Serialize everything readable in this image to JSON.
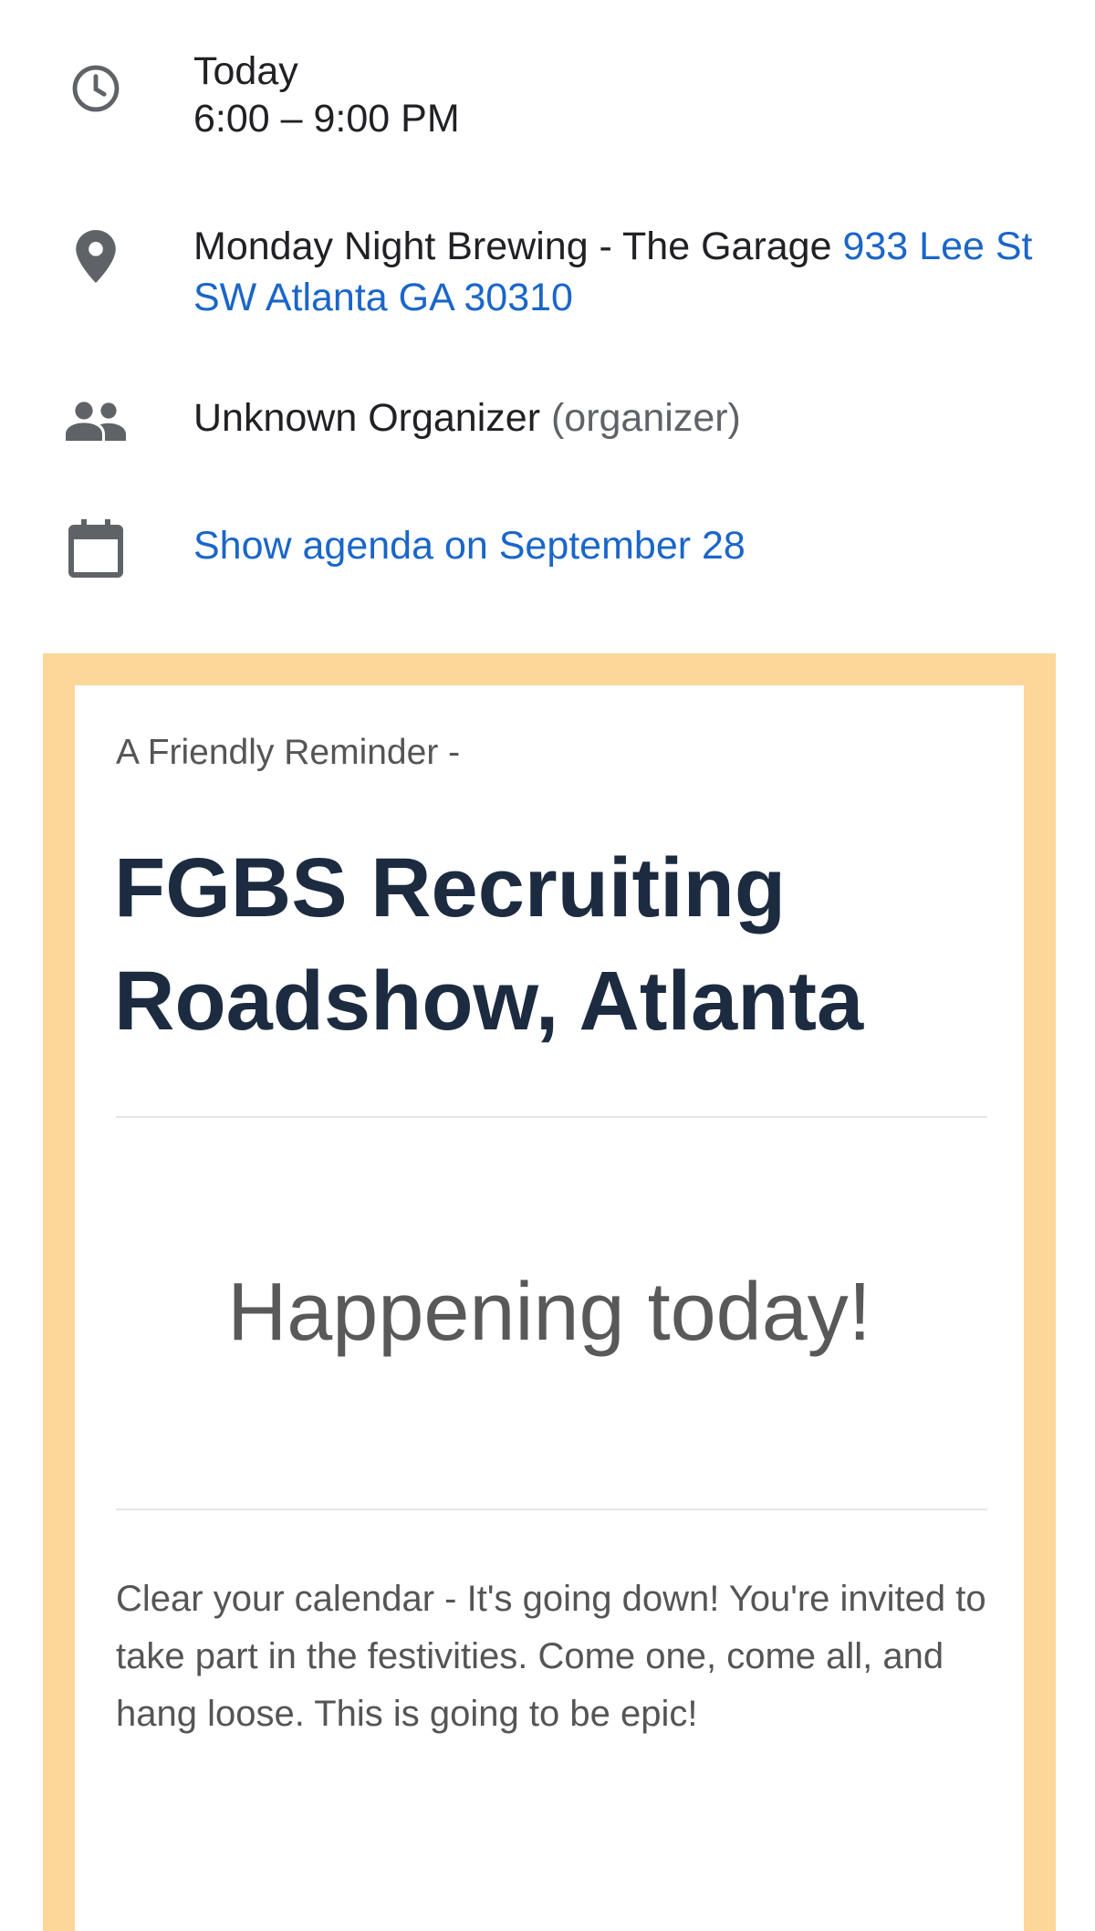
{
  "event_details": {
    "time": {
      "icon": "clock-icon",
      "day": "Today",
      "range": "6:00 – 9:00 PM"
    },
    "location": {
      "icon": "location-pin-icon",
      "venue": "Monday Night Brewing - The Garage",
      "address": "933 Lee St SW Atlanta GA 30310"
    },
    "organizer": {
      "icon": "people-icon",
      "name": "Unknown Organizer",
      "role": "(organizer)"
    },
    "agenda": {
      "icon": "calendar-icon",
      "link_label": "Show agenda on September 28"
    }
  },
  "email": {
    "frame_color": "#fdd699",
    "eyebrow": "A Friendly Reminder -",
    "headline": "FGBS Recruiting Roadshow, Atlanta",
    "callout": "Happening today!",
    "body": "Clear your calendar - It's going down! You're invited to take part in the festivities. Come one, come all, and hang loose. This is going to be epic!"
  },
  "colors": {
    "link": "#1a66c9",
    "icon": "#5f6368",
    "headline": "#1c2b40"
  }
}
